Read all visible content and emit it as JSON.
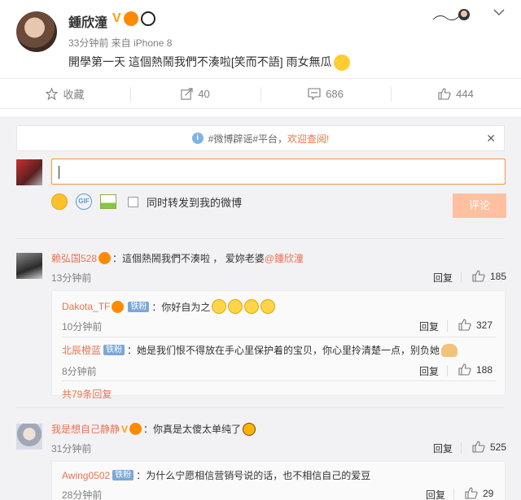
{
  "post": {
    "author": "鍾欣潼",
    "meta": "33分钟前 来自 iPhone 8",
    "text": "開學第一天 這個熱鬧我們不湊啦[笑而不語] 雨女無瓜",
    "dropdown_icon": "chevron-down-icon"
  },
  "actions": {
    "favorite": "收藏",
    "forward": "40",
    "comment": "686",
    "like": "444"
  },
  "notice": {
    "prefix": "#微博辟谣#平台，",
    "link": "欢迎查阅!"
  },
  "composer": {
    "input_value": "",
    "forward_label": "同时转发到我的微博",
    "submit": "评论"
  },
  "comments": [
    {
      "user": "赖弘国528",
      "text": "這個熱鬧我們不湊啦 ，  爱妳老婆",
      "mention": "@鍾欣潼",
      "time": "13分钟前",
      "reply": "回复",
      "likes": "185",
      "replies": [
        {
          "user": "Dakota_TF",
          "badge": "铁粉",
          "text": "你好自为之",
          "time": "10分钟前",
          "reply": "回复",
          "likes": "327"
        },
        {
          "user": "北辰橙蓝",
          "badge": "铁粉",
          "text": "她是我们恨不得放在手心里保护着的宝贝，你心里拎清楚一点，别负她",
          "time": "8分钟前",
          "reply": "回复",
          "likes": "188"
        }
      ],
      "more": "共79条回复"
    },
    {
      "user": "我是想自己静静",
      "text": "你真是太傻太单纯了",
      "time": "31分钟前",
      "reply": "回复",
      "likes": "525",
      "replies": [
        {
          "user": "Awing0502",
          "badge": "铁粉",
          "text": "为什么宁愿相信营销号说的话，也不相信自己的爱豆",
          "time": "28分钟前",
          "reply": "回复",
          "likes": "29"
        }
      ]
    }
  ]
}
